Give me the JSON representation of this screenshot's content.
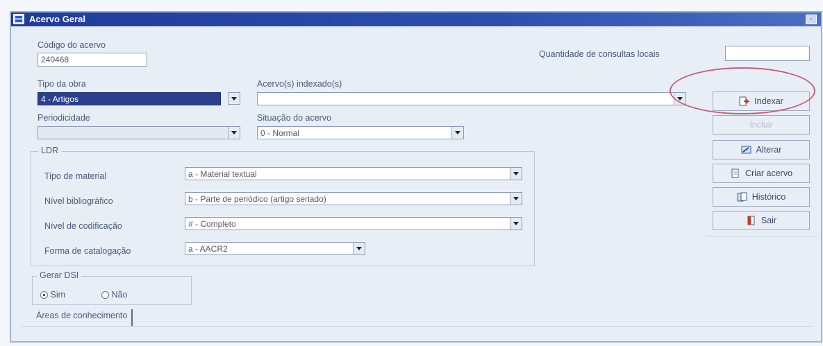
{
  "window": {
    "title": "Acervo Geral",
    "minimize_glyph": "-"
  },
  "fields": {
    "codigo_label": "Código do acervo",
    "codigo_value": "240468",
    "quantidade_label": "Quantidade de consultas locais",
    "quantidade_value": "",
    "tipo_obra_label": "Tipo da obra",
    "tipo_obra_value": "4 - Artigos",
    "acervos_label": "Acervo(s) indexado(s)",
    "acervos_value": "",
    "periodicidade_label": "Periodicidade",
    "periodicidade_value": "",
    "situacao_label": "Situação do acervo",
    "situacao_value": "0 - Normal"
  },
  "ldr": {
    "title": "LDR",
    "tipo_material_label": "Tipo de material",
    "tipo_material_value": "a - Material textual",
    "nivel_bib_label": "Nível bibliográfico",
    "nivel_bib_value": "b - Parte de periódico (artigo seriado)",
    "nivel_cod_label": "Nível de codificação",
    "nivel_cod_value": "# - Completo",
    "forma_cat_label": "Forma de catalogação",
    "forma_cat_value": "a - AACR2"
  },
  "dsi": {
    "title": "Gerar DSI",
    "sim_label": "Sim",
    "nao_label": "Não",
    "selected": "Sim"
  },
  "tabs": {
    "areas_label": "Áreas de conhecimento"
  },
  "buttons": {
    "indexar": "Indexar",
    "incluir": "Incluir",
    "alterar": "Alterar",
    "criar": "Criar acervo",
    "historico": "Histórico",
    "sair": "Sair"
  },
  "colors": {
    "titlebar": "#1f3c99",
    "highlight_circle": "#c5607a",
    "selected_field": "#2b3f8e"
  }
}
